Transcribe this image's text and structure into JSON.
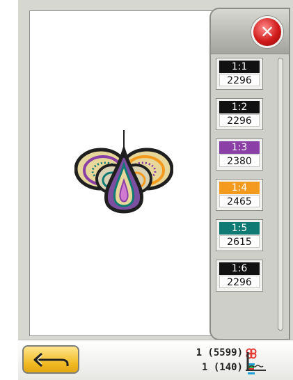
{
  "color_blocks": [
    {
      "label": "1:1",
      "stitches": "2296",
      "color": "#111111"
    },
    {
      "label": "1:2",
      "stitches": "2296",
      "color": "#111111"
    },
    {
      "label": "1:3",
      "stitches": "2380",
      "color": "#8a3fa6"
    },
    {
      "label": "1:4",
      "stitches": "2465",
      "color": "#f39a1f"
    },
    {
      "label": "1:5",
      "stitches": "2615",
      "color": "#0f7a73"
    },
    {
      "label": "1:6",
      "stitches": "2296",
      "color": "#111111"
    }
  ],
  "status": {
    "design_info": "1 (5599)",
    "color_info": "1 (140)"
  },
  "icons": {
    "close": "close-icon",
    "back": "back-arrow-icon",
    "stitches": "stitch-count-icon",
    "spool": "thread-spool-icon",
    "presser_foot": "presser-foot-icon"
  },
  "colors": {
    "close_red": "#d11b1b",
    "back_button_yellow": "#f0b820",
    "panel_gray": "#cfcfc9"
  }
}
